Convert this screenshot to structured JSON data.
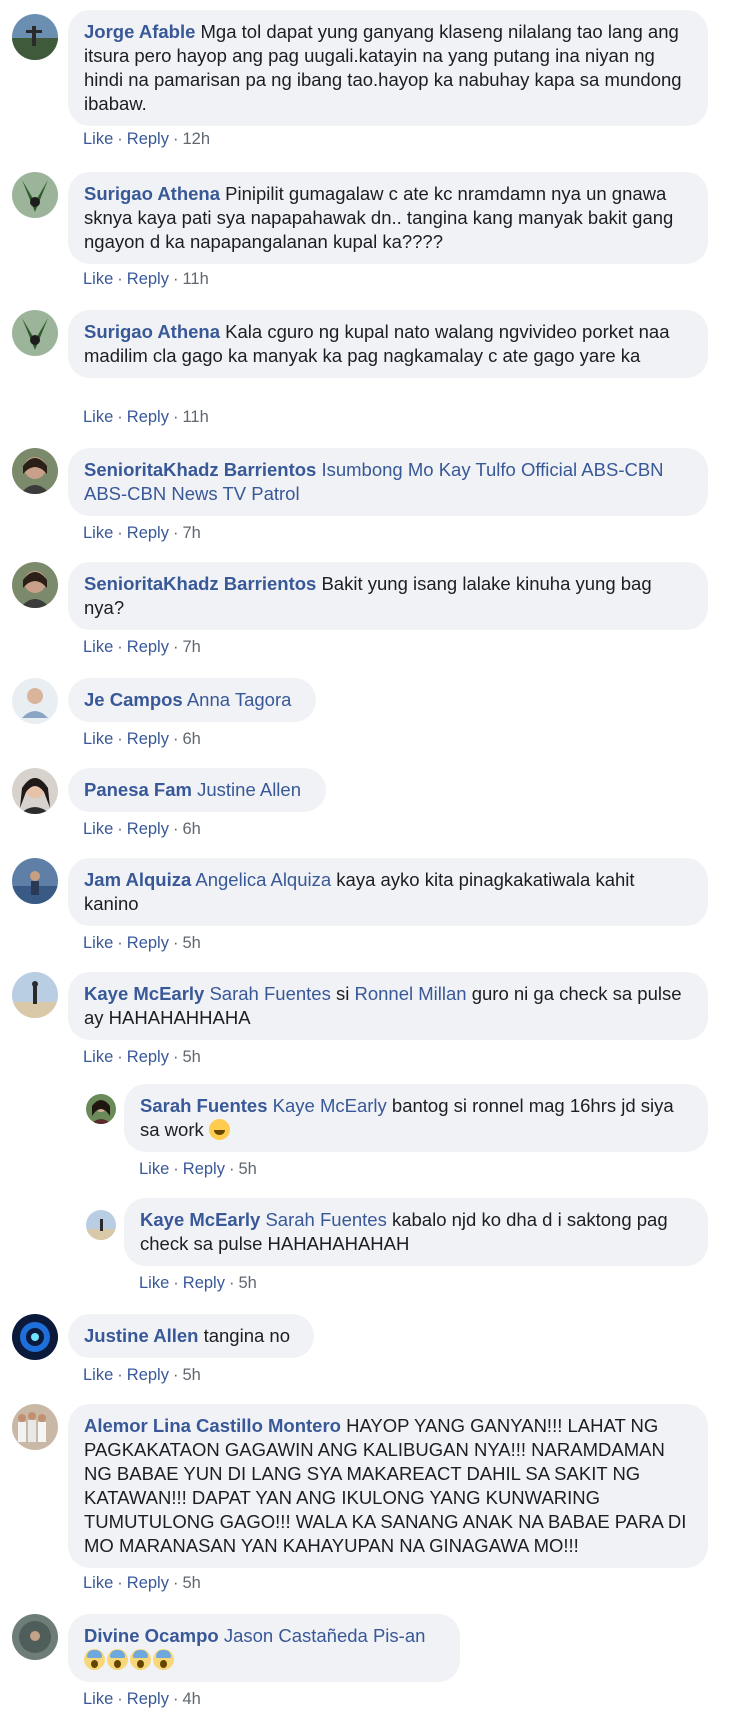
{
  "actions": {
    "like": "Like",
    "reply": "Reply",
    "dot": "·"
  },
  "comments": [
    {
      "author": "Jorge Afable",
      "text": "Mga tol dapat yung ganyang klaseng nilalang tao lang ang itsura pero hayop ang pag uugali.katayin na yang putang ina niyan ng hindi na pamarisan pa ng ibang tao.hayop ka nabuhay kapa sa mundong ibabaw.",
      "time": "12h"
    },
    {
      "author": "Surigao Athena",
      "text": "Pinipilit gumagalaw c ate kc nramdamn nya un gnawa sknya kaya pati sya napapahawak dn.. tangina kang manyak bakit gang ngayon d ka napapangalanan kupal ka????",
      "time": "11h"
    },
    {
      "author": "Surigao Athena",
      "text": "Kala cguro ng kupal nato walang ngvivideo porket naa madilim cla gago ka manyak ka pag nagkamalay c ate gago yare ka",
      "time": "11h"
    },
    {
      "author": "SenioritaKhadz Barrientos",
      "tag1": "Isumbong Mo Kay Tulfo Official",
      "tag2": "ABS-CBN",
      "tag3": "ABS-CBN News",
      "tag4": "TV Patrol",
      "time": "7h"
    },
    {
      "author": "SenioritaKhadz Barrientos",
      "text": "Bakit yung isang lalake kinuha yung bag nya?",
      "time": "7h"
    },
    {
      "author": "Je Campos",
      "tag1": "Anna Tagora",
      "time": "6h"
    },
    {
      "author": "Panesa Fam",
      "tag1": "Justine Allen",
      "time": "6h"
    },
    {
      "author": "Jam Alquiza",
      "tag1": "Angelica Alquiza",
      "text": "kaya ayko kita pinagkakatiwala kahit kanino",
      "time": "5h"
    },
    {
      "author": "Kaye McEarly",
      "tag1": "Sarah Fuentes",
      "mid": "si",
      "tag2": "Ronnel Millan",
      "text": "guro ni ga check sa pulse ay HAHAHAHHAHA",
      "time": "5h"
    },
    {
      "author": "Sarah Fuentes",
      "tag1": "Kaye McEarly",
      "text": "bantog si ronnel mag 16hrs jd siya sa work",
      "emoji": "laughing-tears-emoji",
      "time": "5h"
    },
    {
      "author": "Kaye McEarly",
      "tag1": "Sarah Fuentes",
      "text": "kabalo njd ko dha d i saktong pag check sa pulse HAHAHAHAHAH",
      "time": "5h"
    },
    {
      "author": "Justine Allen",
      "text": "tangina no",
      "time": "5h"
    },
    {
      "author": "Alemor Lina Castillo Montero",
      "text": "HAYOP YANG GANYAN!!! LAHAT NG PAGKAKATAON GAGAWIN ANG KALIBUGAN NYA!!! NARAMDAMAN NG BABAE YUN DI LANG SYA MAKAREACT DAHIL SA SAKIT NG KATAWAN!!! DAPAT YAN ANG IKULONG YANG KUNWARING TUMUTULONG GAGO!!! WALA KA SANANG ANAK NA BABAE PARA DI MO MARANASAN YAN KAHAYUPAN NA GINAGAWA MO!!!",
      "time": "5h"
    },
    {
      "author": "Divine Ocampo",
      "tag1": "Jason Castañeda Pis-an",
      "emoji": "screaming-face-emoji x4",
      "time": "4h"
    }
  ]
}
